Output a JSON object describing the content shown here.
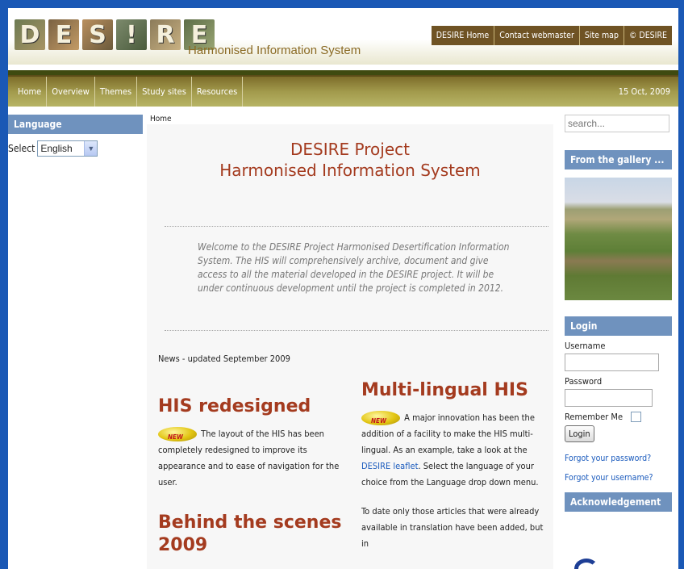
{
  "header": {
    "logo_text": "DESIRE",
    "logo_letters": [
      "D",
      "E",
      "S",
      "!",
      "R",
      "E"
    ],
    "tagline": "Harmonised Information System",
    "links": [
      "DESIRE Home",
      "Contact webmaster",
      "Site map",
      "© DESIRE"
    ]
  },
  "nav": {
    "items": [
      "Home",
      "Overview",
      "Themes",
      "Study sites",
      "Resources"
    ],
    "date": "15 Oct, 2009"
  },
  "language": {
    "title": "Language",
    "select_label": "Select",
    "selected": "English"
  },
  "main": {
    "breadcrumb": "Home",
    "title_line1": "DESIRE Project",
    "title_line2": "Harmonised Information System",
    "welcome": "Welcome to the DESIRE Project Harmonised Desertification Information System. The HIS will comprehensively archive, document and give access to all the material developed in the DESIRE project. It will be under continuous development until the project is completed in 2012.",
    "news_updated": "News - updated September 2009",
    "left_article": {
      "heading": "HIS redesigned",
      "text": "The layout of the HIS has been completely redesigned to improve its appearance and to ease of navigation for the user.",
      "heading2": "Behind the scenes 2009"
    },
    "right_article": {
      "heading": "Multi-lingual HIS",
      "text_before_link": "A major innovation has been the addition of a facility to make the HIS multi-lingual. As an example, take a look at the",
      "link_text": "DESIRE leaflet",
      "text_after_link": ". Select the language of your choice from the Language drop down menu.",
      "text2": "To date only those articles that were already available in translation have been added, but in"
    }
  },
  "sidebar": {
    "search_placeholder": "search...",
    "gallery_title": "From the gallery ...",
    "login_title": "Login",
    "username_label": "Username",
    "password_label": "Password",
    "remember_label": "Remember Me",
    "login_button": "Login",
    "forgot_password": "Forgot your password?",
    "forgot_username": "Forgot your username?",
    "ack_title": "Acknowledgement"
  }
}
